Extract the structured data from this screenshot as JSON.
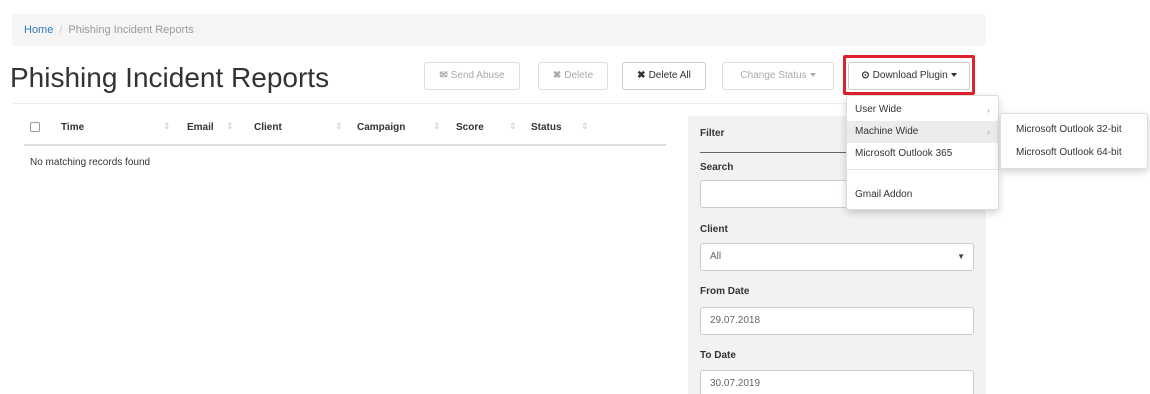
{
  "breadcrumb": {
    "home": "Home",
    "separator": "/",
    "current": "Phishing Incident Reports"
  },
  "page_title": "Phishing Incident Reports",
  "toolbar": {
    "send_abuse": "Send Abuse",
    "delete": "Delete",
    "delete_all": "Delete All",
    "change_status": "Change Status",
    "download_plugin": "Download Plugin"
  },
  "table": {
    "columns": [
      "Time",
      "Email",
      "Client",
      "Campaign",
      "Score",
      "Status"
    ],
    "empty_message": "No matching records found"
  },
  "filter": {
    "title": "Filter",
    "search_label": "Search",
    "search_value": "",
    "client_label": "Client",
    "client_selected": "All",
    "from_date_label": "From Date",
    "from_date_value": "29.07.2018",
    "to_date_label": "To Date",
    "to_date_value": "30.07.2019"
  },
  "download_menu": {
    "items": [
      "User Wide",
      "Machine Wide",
      "Microsoft Outlook 365",
      "Gmail Addon"
    ],
    "active_item": "Machine Wide",
    "submenu": [
      "Microsoft Outlook 32-bit",
      "Microsoft Outlook 64-bit"
    ]
  },
  "colors": {
    "highlight": "#e0202a",
    "link": "#337ab7"
  }
}
